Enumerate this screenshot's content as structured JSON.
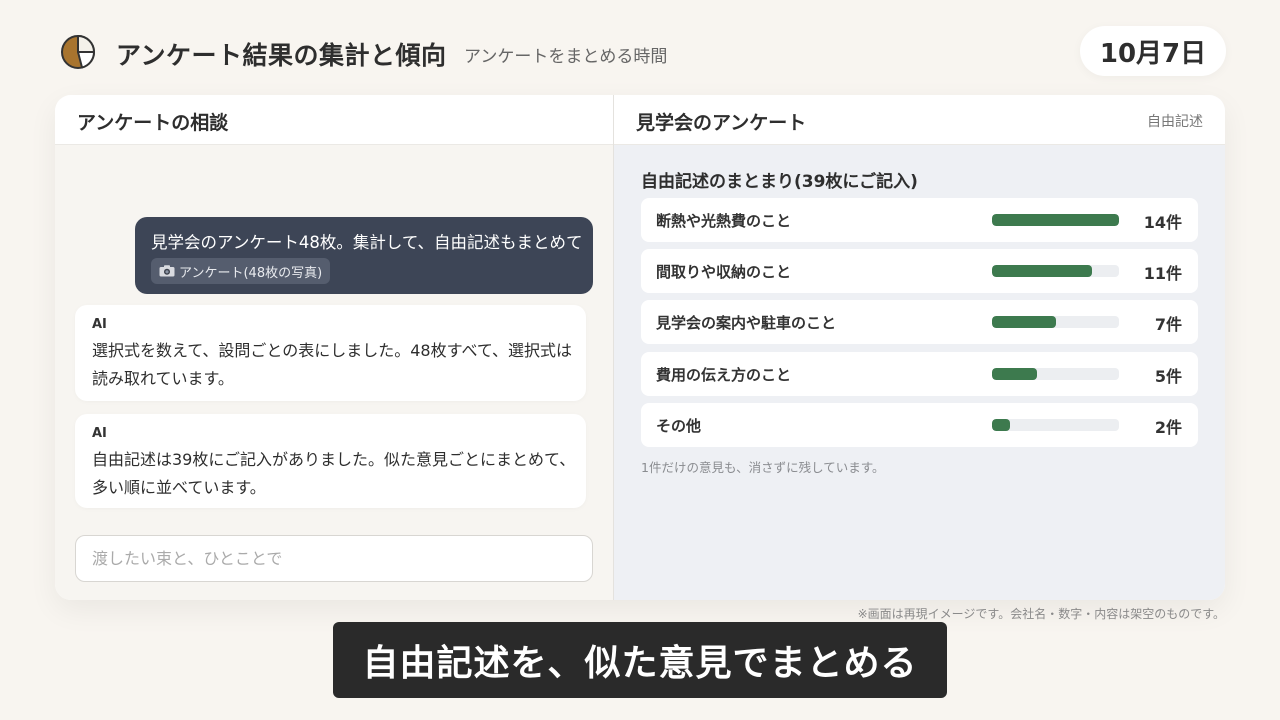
{
  "header": {
    "logo_icon": "pie-chart-icon",
    "title": "アンケート結果の集計と傾向",
    "subtitle": "アンケートをまとめる時間",
    "date": "10月7日"
  },
  "chat_panel": {
    "title": "アンケートの相談",
    "user_message": {
      "text": "見学会のアンケート48枚。集計して、自由記述もまとめて",
      "attachment_icon": "camera-icon",
      "attachment_label": "アンケート(48枚の写真)"
    },
    "ai_messages": [
      {
        "sender": "AI",
        "text": "選択式を数えて、設問ごとの表にしました。48枚すべて、選択式は読み取れています。"
      },
      {
        "sender": "AI",
        "text": "自由記述は39枚にご記入がありました。似た意見ごとにまとめて、多い順に並べています。"
      }
    ],
    "input_placeholder": "渡したい束と、ひとことで"
  },
  "summary_panel": {
    "title": "見学会のアンケート",
    "tag": "自由記述",
    "heading": "自由記述のまとまり(39枚にご記入)",
    "bar_color": "#3d7a4e",
    "items": [
      {
        "label": "断熱や光熱費のこと",
        "count": 14,
        "count_label": "14件"
      },
      {
        "label": "間取りや収納のこと",
        "count": 11,
        "count_label": "11件"
      },
      {
        "label": "見学会の案内や駐車のこと",
        "count": 7,
        "count_label": "7件"
      },
      {
        "label": "費用の伝え方のこと",
        "count": 5,
        "count_label": "5件"
      },
      {
        "label": "その他",
        "count": 2,
        "count_label": "2件"
      }
    ],
    "note": "1件だけの意見も、消さずに残しています。"
  },
  "footnote": "※画面は再現イメージです。会社名・数字・内容は架空のものです。",
  "caption": "自由記述を、似た意見でまとめる"
}
